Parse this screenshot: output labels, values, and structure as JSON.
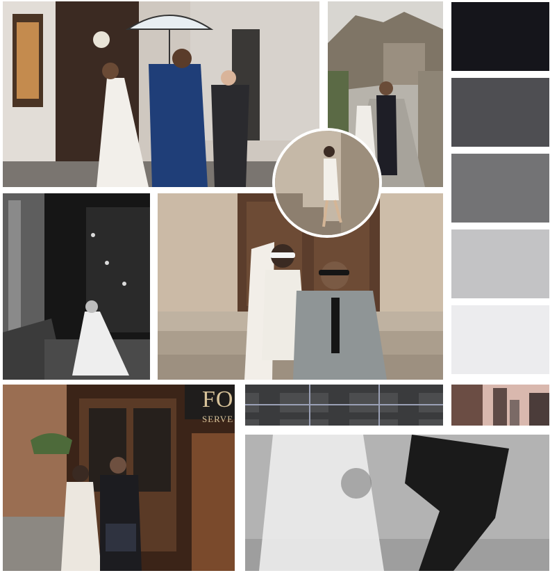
{
  "palette": {
    "swatches": [
      "#15151b",
      "#4e4e52",
      "#737375",
      "#c3c3c5",
      "#ececee"
    ]
  },
  "shop_sign": {
    "line1": "FO",
    "line2": "SERVE"
  },
  "tartan": {
    "base": "#4c4d4f",
    "stripe": "#9aa0b6"
  }
}
